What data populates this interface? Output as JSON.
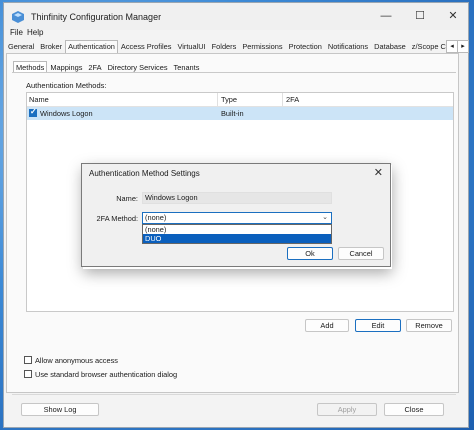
{
  "window": {
    "title": "Thinfinity Configuration Manager",
    "controls": {
      "minimize": "—",
      "maximize": "☐",
      "close": "✕"
    }
  },
  "menu": [
    "File",
    "Help"
  ],
  "tabs": [
    {
      "label": "General"
    },
    {
      "label": "Broker"
    },
    {
      "label": "Authentication",
      "active": true
    },
    {
      "label": "Access Profiles"
    },
    {
      "label": "VirtualUI"
    },
    {
      "label": "Folders"
    },
    {
      "label": "Permissions"
    },
    {
      "label": "Protection"
    },
    {
      "label": "Notifications"
    },
    {
      "label": "Database"
    },
    {
      "label": "z/Scope Clas"
    }
  ],
  "tab_scroll": {
    "left": "◂",
    "right": "▸"
  },
  "subtabs": [
    {
      "label": "Methods",
      "active": true
    },
    {
      "label": "Mappings"
    },
    {
      "label": "2FA"
    },
    {
      "label": "Directory Services"
    },
    {
      "label": "Tenants"
    }
  ],
  "auth_methods": {
    "label": "Authentication Methods:",
    "columns": [
      "Name",
      "Type",
      "2FA"
    ],
    "rows": [
      {
        "name": "Windows Logon",
        "type": "Built-in",
        "twofa": "",
        "checked": true
      }
    ]
  },
  "list_buttons": {
    "add": "Add",
    "edit": "Edit",
    "remove": "Remove"
  },
  "options": {
    "allow_anonymous": "Allow anonymous access",
    "standard_browser_auth": "Use standard browser authentication dialog"
  },
  "footer": {
    "show_log": "Show Log",
    "apply": "Apply",
    "close": "Close"
  },
  "dialog": {
    "title": "Authentication Method Settings",
    "close": "✕",
    "name_label": "Name:",
    "name_value": "Windows Logon",
    "twofa_label": "2FA Method:",
    "twofa_value": "(none)",
    "options": [
      {
        "label": "(none)"
      },
      {
        "label": "DUO",
        "highlighted": true
      }
    ],
    "ok": "Ok",
    "cancel": "Cancel"
  },
  "colors": {
    "accent": "#1b6fc0",
    "selection": "#cce4f7",
    "dropdown_highlight": "#0a5fbd"
  }
}
